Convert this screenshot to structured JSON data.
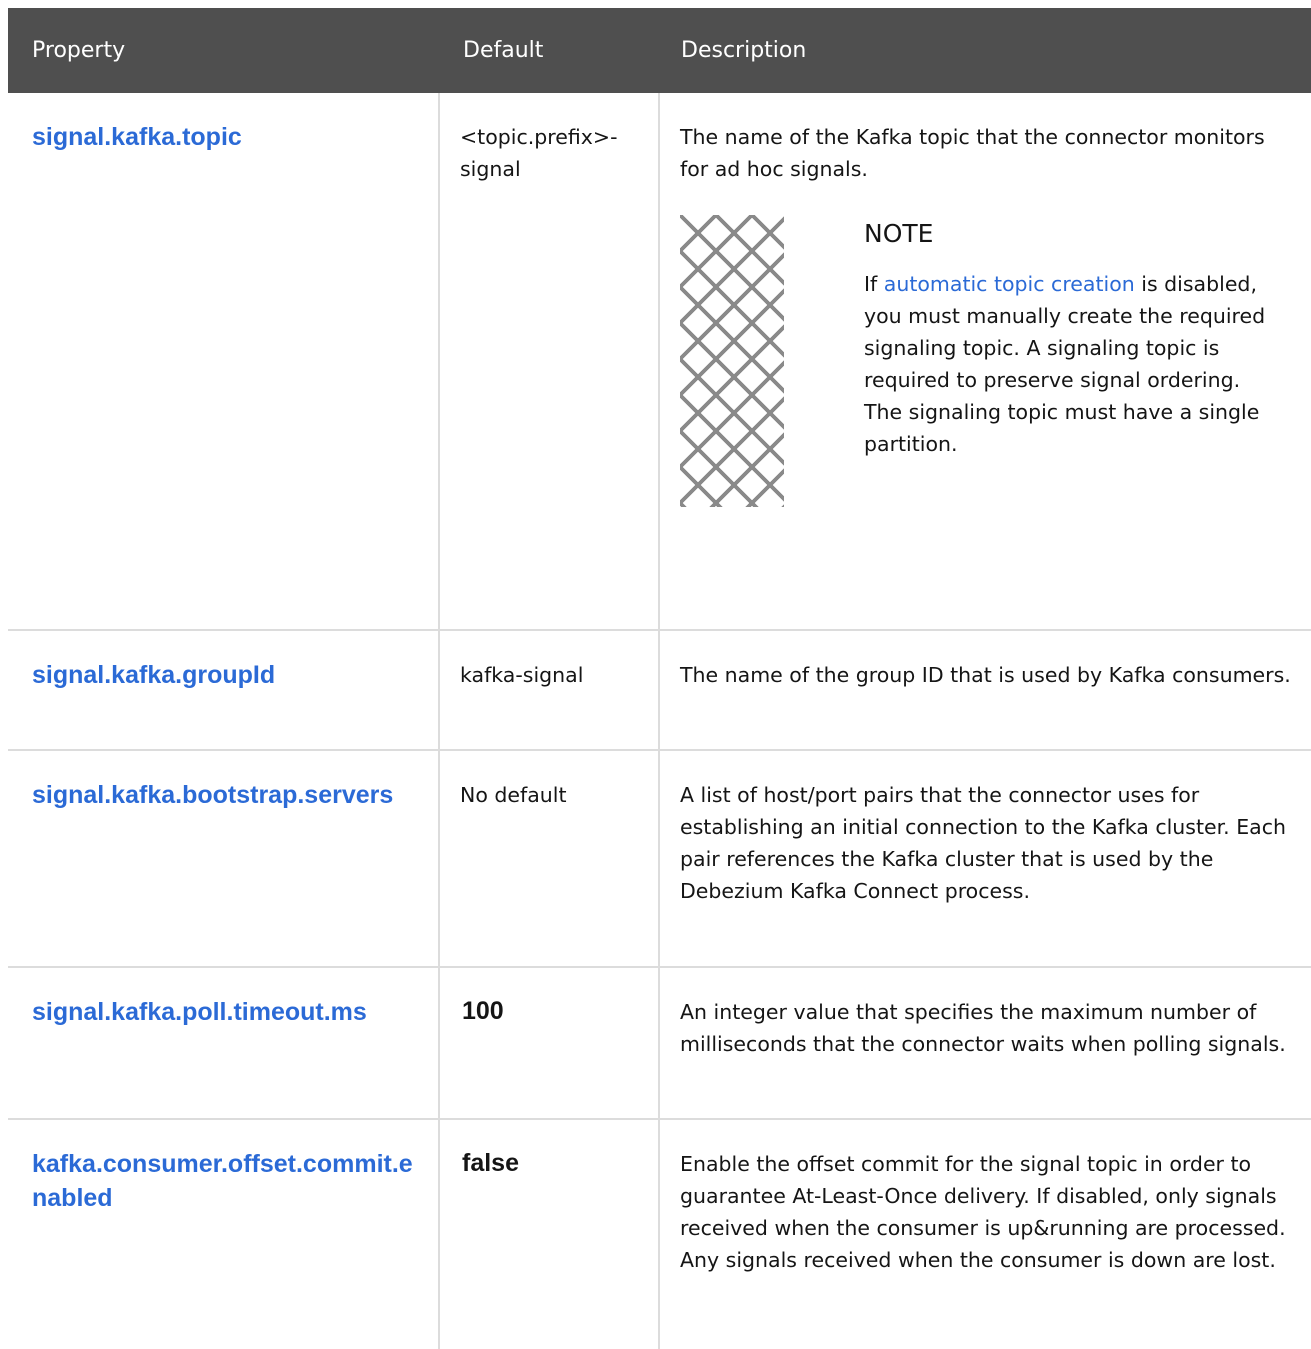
{
  "table": {
    "headers": {
      "property": "Property",
      "default": "Default",
      "description": "Description"
    },
    "rows": [
      {
        "property": "signal.kafka.topic",
        "default": "<topic.prefix>-signal",
        "description": "The name of the Kafka topic that the connector monitors for ad hoc signals.",
        "note": {
          "title": "NOTE",
          "text_before": "If ",
          "link": "automatic topic creation",
          "text_after": " is disabled, you must manually create the required signaling topic. A signaling topic is required to preserve signal ordering. The signaling topic must have a single partition."
        }
      },
      {
        "property": "signal.kafka.groupId",
        "default": "kafka-signal",
        "description": "The name of the group ID that is used by Kafka consumers."
      },
      {
        "property": "signal.kafka.bootstrap.servers",
        "default": "No default",
        "description": "A list of host/port pairs that the connector uses for establishing an initial connection to the Kafka cluster. Each pair references the Kafka cluster that is used by the Debezium Kafka Connect process."
      },
      {
        "property": "signal.kafka.poll.timeout.ms",
        "default": "100",
        "description": "An integer value that specifies the maximum number of milliseconds that the connector waits when polling signals."
      },
      {
        "property": "kafka.consumer.offset.commit.enabled",
        "default": "false",
        "description": "Enable the offset commit for the signal topic in order to guarantee At-Least-Once delivery. If disabled, only signals received when the consumer is up&running are processed. Any signals received when the consumer is down are lost."
      }
    ]
  },
  "colors": {
    "header_bg": "#4f4f4f",
    "link": "#2b6ad6",
    "border": "#dcdcdc"
  },
  "icons": {
    "note": "note-pattern-icon"
  }
}
